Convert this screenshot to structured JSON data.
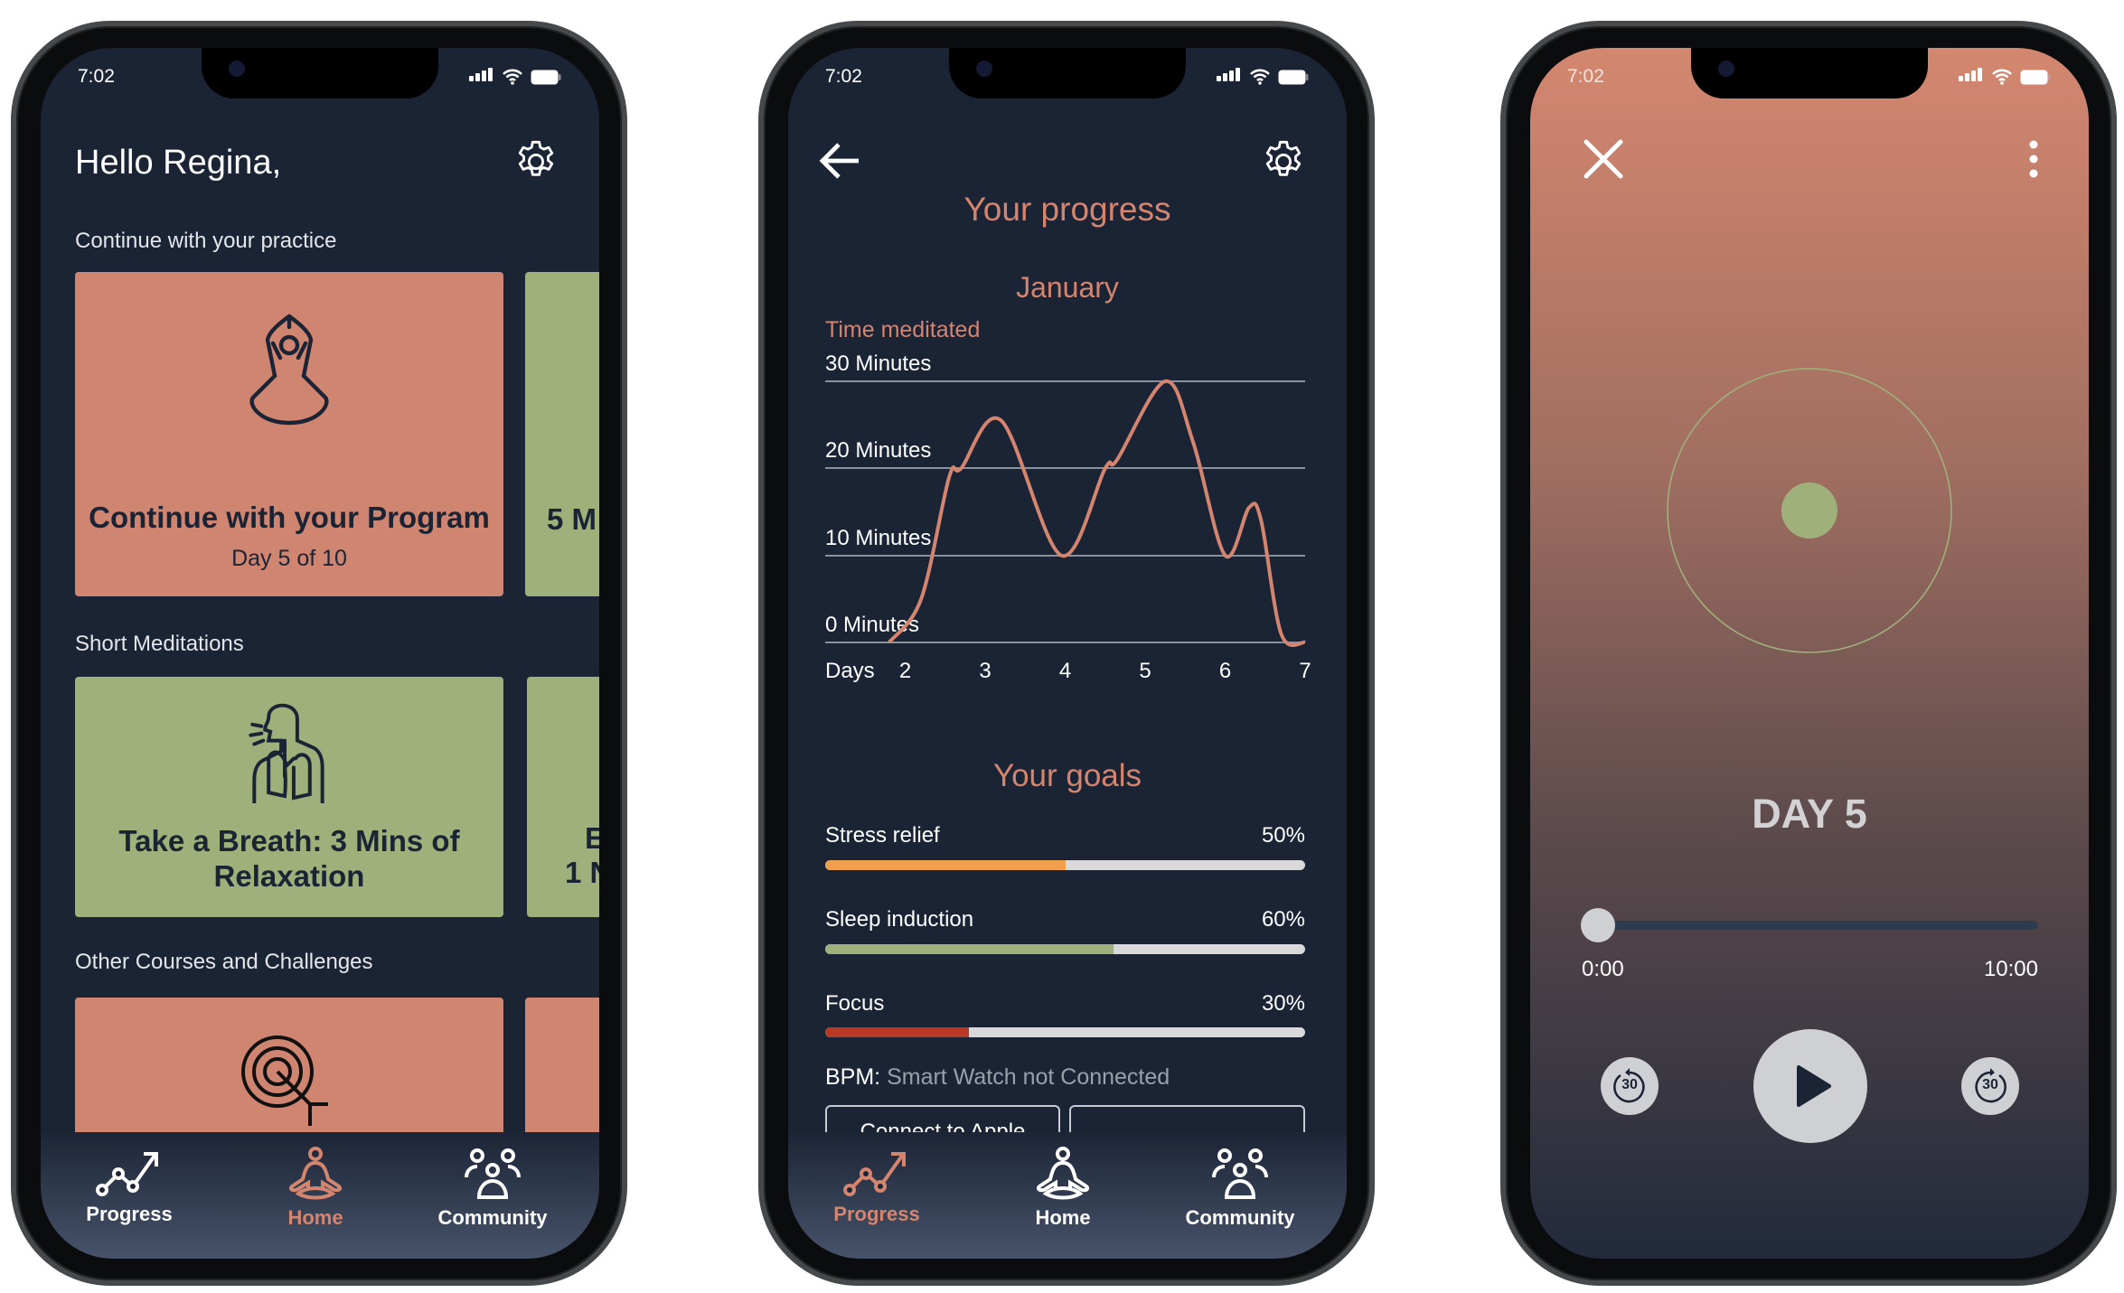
{
  "status_time": "7:02",
  "nav": {
    "progress": "Progress",
    "home": "Home",
    "community": "Community"
  },
  "home": {
    "greeting": "Hello Regina,",
    "section_practice": "Continue with your practice",
    "program_card": {
      "title": "Continue with your Program",
      "subtitle": "Day 5 of 10"
    },
    "peek_card_1": "5 M",
    "section_short": "Short Meditations",
    "breath_card": {
      "title_line1": "Take a Breath: 3 Mins of",
      "title_line2": "Relaxation"
    },
    "peek_card_2_line1": "E",
    "peek_card_2_line2": "1 N",
    "section_other": "Other Courses and Challenges"
  },
  "progress": {
    "title": "Your progress",
    "month": "January",
    "goals_title": "Your goals",
    "goals": [
      {
        "label": "Stress relief",
        "value": "50%",
        "fraction": 0.5,
        "color": "#f0a04b"
      },
      {
        "label": "Sleep induction",
        "value": "60%",
        "fraction": 0.6,
        "color": "#a0b07a"
      },
      {
        "label": "Focus",
        "value": "30%",
        "fraction": 0.3,
        "color": "#b83a25"
      }
    ],
    "bpm_label": "BPM:",
    "bpm_value": "Smart Watch not Connected",
    "connect_apple": "Connect to Apple"
  },
  "chart_data": {
    "type": "line",
    "title": "Time meditated",
    "xlabel": "Days",
    "x_ticks": [
      "2",
      "3",
      "4",
      "5",
      "6",
      "7"
    ],
    "y_ticks": [
      "0 Minutes",
      "10 Minutes",
      "20 Minutes",
      "30 Minutes"
    ],
    "xlim": [
      1.0,
      7.0
    ],
    "ylim": [
      0,
      30
    ],
    "color": "#d4856f",
    "points": [
      [
        1.8,
        0
      ],
      [
        2.2,
        5
      ],
      [
        2.55,
        19
      ],
      [
        2.7,
        20
      ],
      [
        3.2,
        25.5
      ],
      [
        3.95,
        10
      ],
      [
        4.5,
        20
      ],
      [
        4.65,
        21
      ],
      [
        5.25,
        30
      ],
      [
        5.6,
        23
      ],
      [
        6.0,
        10
      ],
      [
        6.3,
        15.5
      ],
      [
        6.45,
        14
      ],
      [
        6.7,
        1
      ],
      [
        7.0,
        0
      ]
    ]
  },
  "player": {
    "title": "DAY 5",
    "elapsed": "0:00",
    "duration": "10:00",
    "progress_fraction": 0,
    "skip_back": "30",
    "skip_forward": "30"
  }
}
